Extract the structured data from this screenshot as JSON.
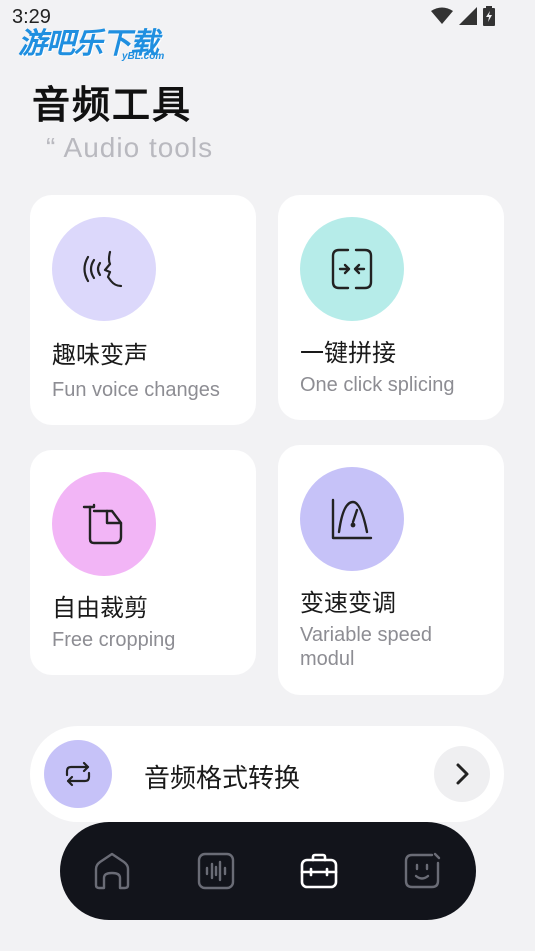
{
  "status_bar": {
    "time": "3:29"
  },
  "watermark": {
    "brand": "游吧乐下载",
    "domain": "yBL.com"
  },
  "header": {
    "title": "音频工具",
    "subtitle": "“ Audio tools"
  },
  "cards": [
    {
      "title": "趣味变声",
      "subtitle": "Fun voice changes",
      "icon": "voice-face-icon",
      "color": "#dcd8fb"
    },
    {
      "title": "一键拼接",
      "subtitle": "One click splicing",
      "icon": "splice-icon",
      "color": "#b6ece9"
    },
    {
      "title": "自由裁剪",
      "subtitle": "Free cropping",
      "icon": "crop-icon",
      "color": "#f2b5f6"
    },
    {
      "title": "变速变调",
      "subtitle": "Variable speed modul",
      "icon": "metronome-icon",
      "color": "#c6c2f8"
    }
  ],
  "format_conversion": {
    "label": "音频格式转换",
    "icon": "convert-icon",
    "color": "#c6c2f8"
  },
  "bottom_nav": {
    "items": [
      {
        "name": "home",
        "icon": "home-icon",
        "active": false
      },
      {
        "name": "audio",
        "icon": "waveform-icon",
        "active": false
      },
      {
        "name": "tools",
        "icon": "toolbox-icon",
        "active": true
      },
      {
        "name": "profile",
        "icon": "face-icon",
        "active": false
      }
    ]
  }
}
